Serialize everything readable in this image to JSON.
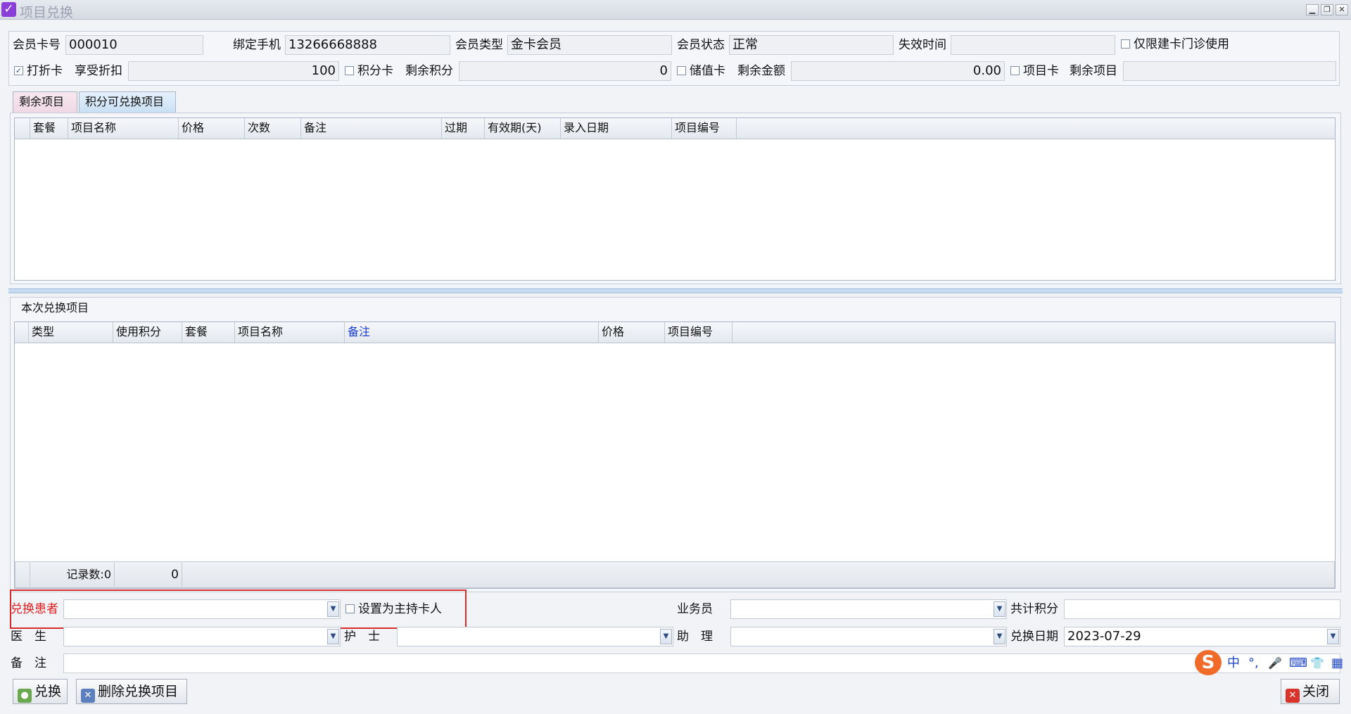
{
  "window": {
    "title": "项目兑换",
    "controls": {
      "minimize": "▁",
      "restore": "❐",
      "close": "✕"
    }
  },
  "member": {
    "card_no_label": "会员卡号",
    "card_no": "000010",
    "phone_label": "绑定手机",
    "phone": "13266668888",
    "type_label": "会员类型",
    "type": "金卡会员",
    "status_label": "会员状态",
    "status": "正常",
    "expire_label": "失效时间",
    "expire": "",
    "clinic_only_label": "仅限建卡门诊使用",
    "clinic_only_checked": false
  },
  "cards": {
    "discount_label": "打折卡",
    "discount_checked": true,
    "discount_rate_label": "享受折扣",
    "discount_rate": "100",
    "points_label": "积分卡",
    "points_checked": false,
    "points_remaining_label": "剩余积分",
    "points_remaining": "0",
    "stored_label": "储值卡",
    "stored_checked": false,
    "balance_label": "剩余金额",
    "balance": "0.00",
    "item_label": "项目卡",
    "item_checked": false,
    "items_remaining_label": "剩余项目",
    "items_remaining": ""
  },
  "tabs": [
    {
      "label": "剩余项目",
      "active": true
    },
    {
      "label": "积分可兑换项目",
      "active": false
    }
  ],
  "remaining_grid": {
    "columns": [
      "套餐",
      "项目名称",
      "价格",
      "次数",
      "备注",
      "过期",
      "有效期(天)",
      "录入日期",
      "项目编号"
    ],
    "rows": []
  },
  "exchange_group": {
    "title": "本次兑换项目",
    "columns": [
      "类型",
      "使用积分",
      "套餐",
      "项目名称",
      "备注",
      "价格",
      "项目编号"
    ],
    "highlight_color": "#1a3ccc",
    "rows": [],
    "record_count_label": "记录数:0",
    "record_sum": "0"
  },
  "form": {
    "patient_label": "兑换患者",
    "patient_label_color": "#e02020",
    "patient": "",
    "set_holder_label": "设置为主持卡人",
    "set_holder_checked": false,
    "salesman_label": "业务员",
    "salesman": "",
    "total_points_label": "共计积分",
    "total_points": "",
    "doctor_label": "医　生",
    "doctor": "",
    "nurse_label": "护　士",
    "nurse": "",
    "assistant_label": "助　理",
    "assistant": "",
    "date_label": "兑换日期",
    "date": "2023-07-29",
    "remark_label": "备　注",
    "remark": ""
  },
  "buttons": {
    "exchange": "兑换",
    "delete_item": "删除兑换项目",
    "close": "关闭"
  },
  "ime": {
    "logo": "S",
    "lang": "中",
    "punct": "°,",
    "mic": "🎤",
    "keyboard": "⌨",
    "skin": "👕",
    "apps": "▦"
  }
}
